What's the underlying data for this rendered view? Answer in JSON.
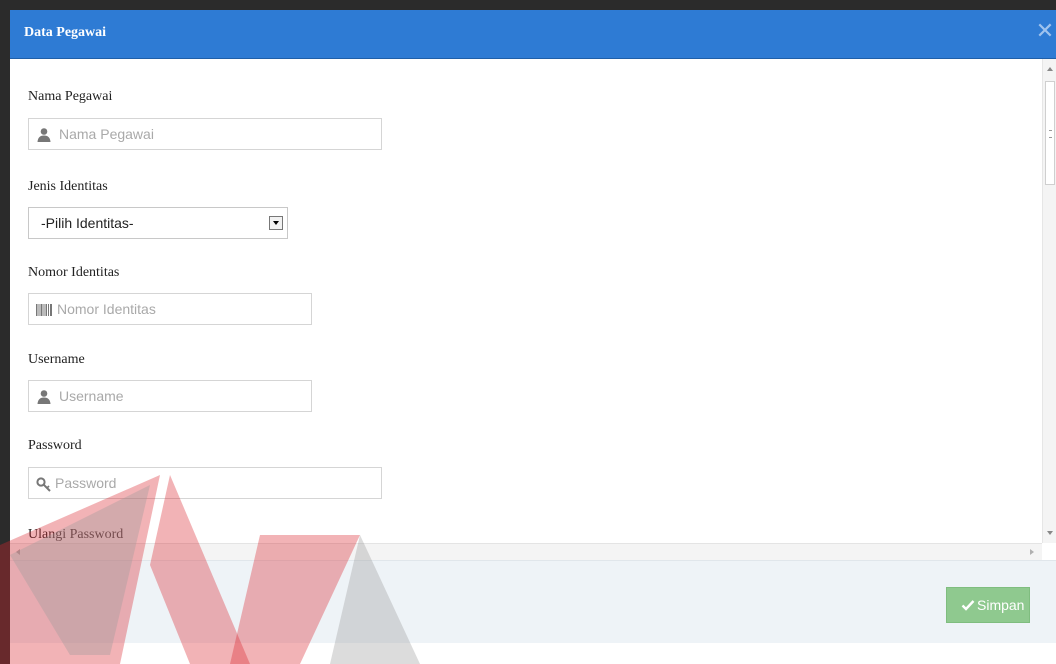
{
  "modal": {
    "title": "Data Pegawai",
    "close_icon": "close-icon"
  },
  "form": {
    "nama_label": "Nama Pegawai",
    "nama_placeholder": "Nama Pegawai",
    "jenis_label": "Jenis Identitas",
    "jenis_selected": "-Pilih Identitas-",
    "nomor_label": "Nomor Identitas",
    "nomor_placeholder": "Nomor Identitas",
    "username_label": "Username",
    "username_placeholder": "Username",
    "password_label": "Password",
    "password_placeholder": "Password",
    "ulangi_label": "Ulangi Password"
  },
  "footer": {
    "save_label": "Simpan"
  },
  "colors": {
    "header": "#2e7bd4",
    "save_button": "#8fc98f",
    "watermark_red": "#d9262e",
    "watermark_gray": "#9a9a9a"
  }
}
